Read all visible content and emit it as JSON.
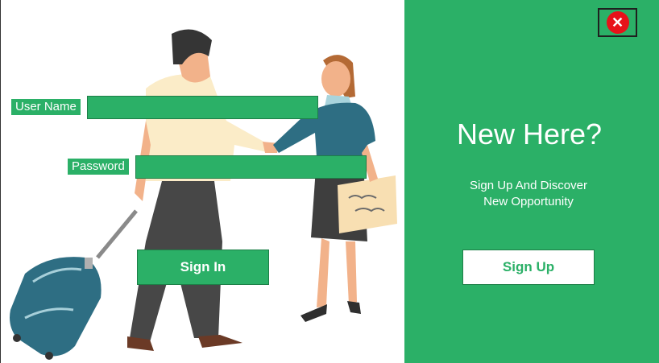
{
  "login": {
    "username_label": "User Name",
    "username_value": "",
    "password_label": "Password",
    "password_value": "",
    "signin_label": "Sign In"
  },
  "panel": {
    "title": "New Here?",
    "subtitle_line1": "Sign Up And Discover",
    "subtitle_line2": "New Opportunity",
    "signup_label": "Sign Up",
    "close_glyph": "✕"
  },
  "icons": {
    "close": "close-icon"
  },
  "colors": {
    "accent": "#2bb067",
    "close_red": "#e8121a",
    "background": "#ffffff"
  }
}
